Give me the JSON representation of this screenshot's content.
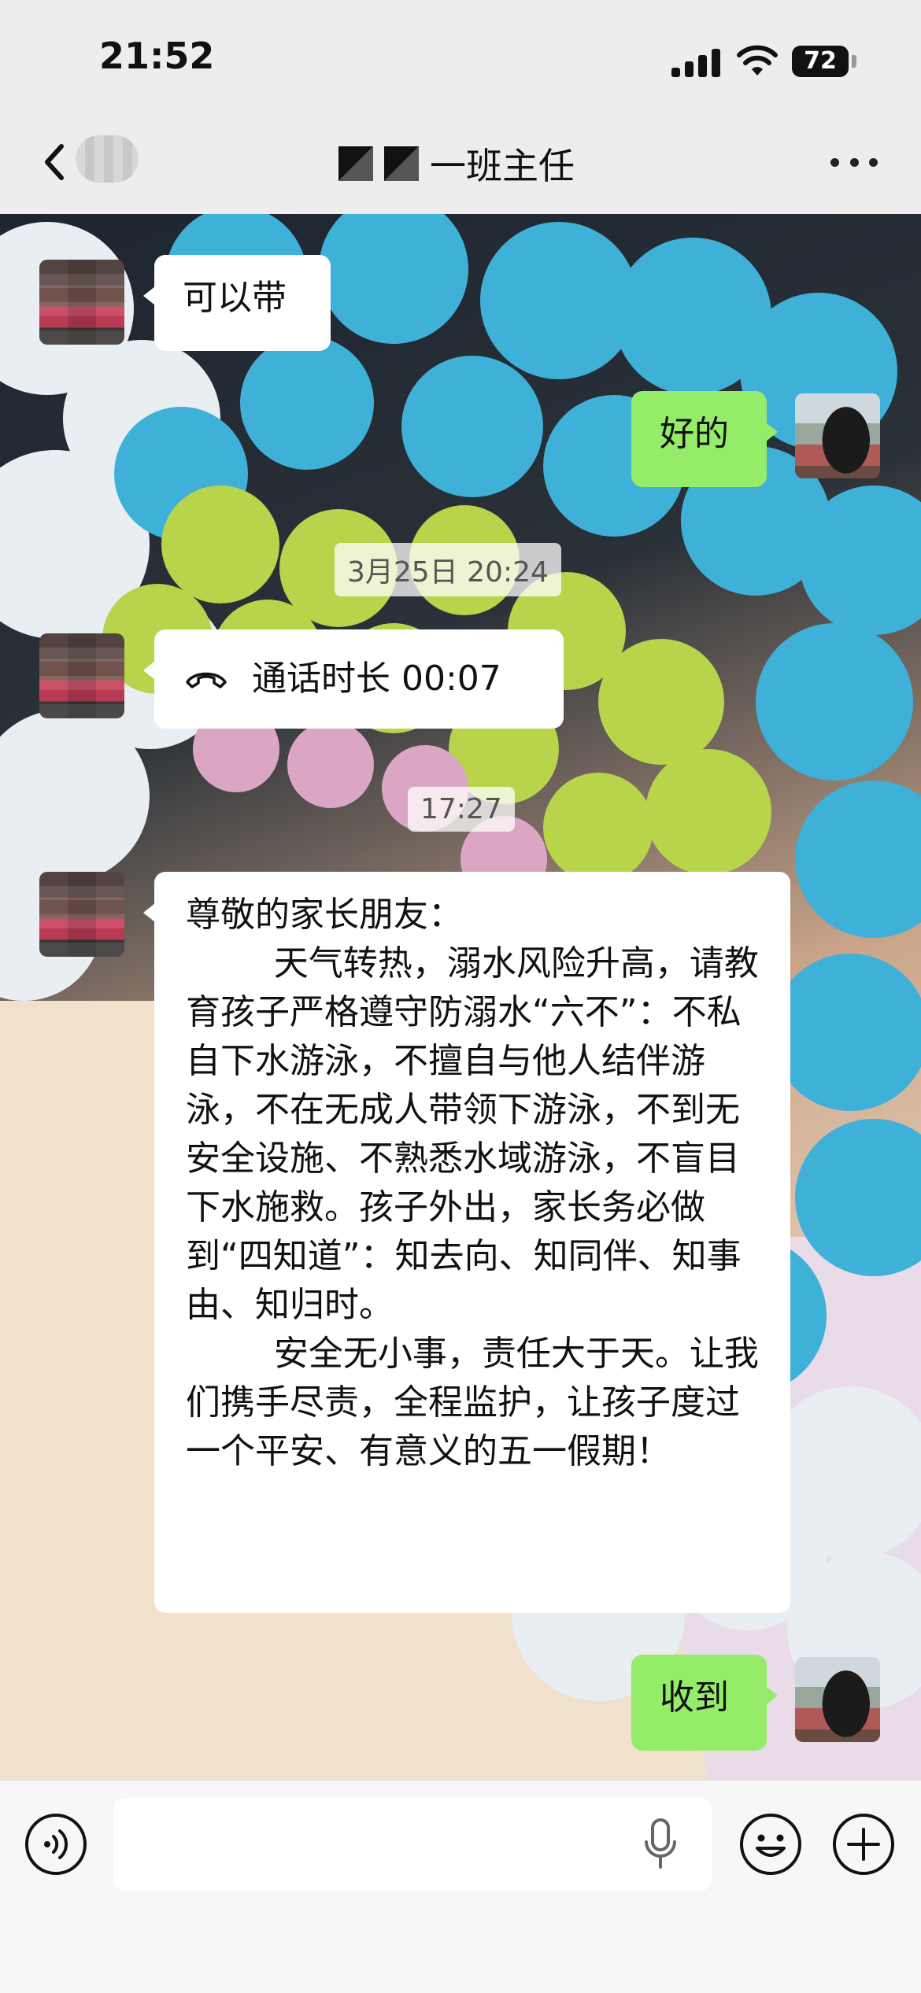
{
  "status_bar": {
    "time": "21:52",
    "battery": "72"
  },
  "header": {
    "title_suffix": "一班主任"
  },
  "messages": {
    "m1": "可以带",
    "m2": "好的",
    "ts1": "3月25日 20:24",
    "call": "通话时长 00:07",
    "ts2": "17:27",
    "notice": "尊敬的家长朋友：\n        天气转热，溺水风险升高，请教育孩子严格遵守防溺水“六不”：不私自下水游泳，不擅自与他人结伴游泳，不在无成人带领下游泳，不到无安全设施、不熟悉水域游泳，不盲目下水施救。孩子外出，家长务必做到“四知道”：知去向、知同伴、知事由、知归时。\n        安全无小事，责任大于天。让我们携手尽责，全程监护，让孩子度过一个平安、有意义的五一假期！",
    "m3": "收到"
  },
  "icons": {
    "back": "chevron-left-icon",
    "more": "more-dots-icon",
    "voice": "voice-mode-icon",
    "mic": "microphone-icon",
    "emoji": "emoji-icon",
    "plus": "plus-icon",
    "call": "phone-hangup-icon"
  },
  "colors": {
    "self_bubble": "#95ec69",
    "other_bubble": "#ffffff",
    "bar_bg": "#ededed"
  }
}
